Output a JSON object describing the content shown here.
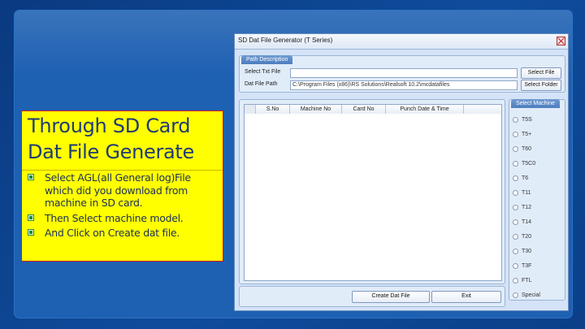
{
  "slide": {
    "title": "Through SD Card Dat File Generate",
    "bullets": [
      "Select AGL(all General log)File which did you download from machine in SD card.",
      "Then Select machine model.",
      "And Click on Create dat file."
    ]
  },
  "dialog": {
    "title": "SD Dat File Generator (T Series)",
    "path_group": {
      "tab": "Path Description",
      "select_txt_label": "Select Txt File",
      "select_txt_value": "",
      "dat_path_label": "Dat File Path",
      "dat_path_value": "C:\\Program Files (x86)\\RS Solutions\\Realsoft 10.2\\mcdatafiles",
      "select_file_button": "Select File",
      "select_folder_button": "Select Folder"
    },
    "grid": {
      "columns": [
        "S.No",
        "Machine No",
        "Card No",
        "Punch Date & Time"
      ]
    },
    "machine_group": {
      "tab": "Select Machine",
      "options": [
        "T5S",
        "T5+",
        "T60",
        "T5C0",
        "T6",
        "T11",
        "T12",
        "T14",
        "T20",
        "T30",
        "T3F",
        "FTL",
        "Special"
      ]
    },
    "buttons": {
      "create": "Create Dat File",
      "exit": "Exit"
    }
  }
}
